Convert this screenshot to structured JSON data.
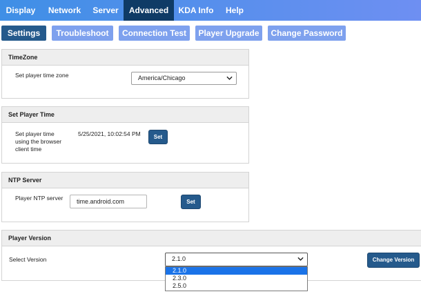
{
  "top_nav": {
    "items": [
      {
        "label": "Display"
      },
      {
        "label": "Network"
      },
      {
        "label": "Server"
      },
      {
        "label": "Advanced"
      },
      {
        "label": "KDA Info"
      },
      {
        "label": "Help"
      }
    ],
    "active": "Advanced"
  },
  "sub_tabs": {
    "items": [
      {
        "label": "Settings"
      },
      {
        "label": "Troubleshoot"
      },
      {
        "label": "Connection Test"
      },
      {
        "label": "Player Upgrade"
      },
      {
        "label": "Change Password"
      }
    ],
    "active": "Settings"
  },
  "timezone": {
    "header": "TimeZone",
    "label": "Set player time zone",
    "selected": "America/Chicago"
  },
  "player_time": {
    "header": "Set Player Time",
    "label_lines": [
      "Set player time",
      "using the browser",
      "client time"
    ],
    "datetime": "5/25/2021, 10:02:54 PM",
    "button": "Set"
  },
  "ntp": {
    "header": "NTP Server",
    "label": "Player NTP server",
    "value": "time.android.com",
    "button": "Set"
  },
  "player_version": {
    "header": "Player Version",
    "label": "Select Version",
    "selected": "2.1.0",
    "options": [
      "2.1.0",
      "2.3.0",
      "2.5.0"
    ],
    "button": "Change Version"
  },
  "colors": {
    "nav_gradient_start": "#3f8fe6",
    "nav_gradient_end": "#6e8ff2",
    "nav_active": "#0f3b66",
    "subtab": "#7ea1ee",
    "subtab_active": "#255a8c",
    "button": "#255a8c",
    "dropdown_highlight": "#1a73e8"
  },
  "icons": {
    "select_arrow": "chevron-down-icon"
  }
}
